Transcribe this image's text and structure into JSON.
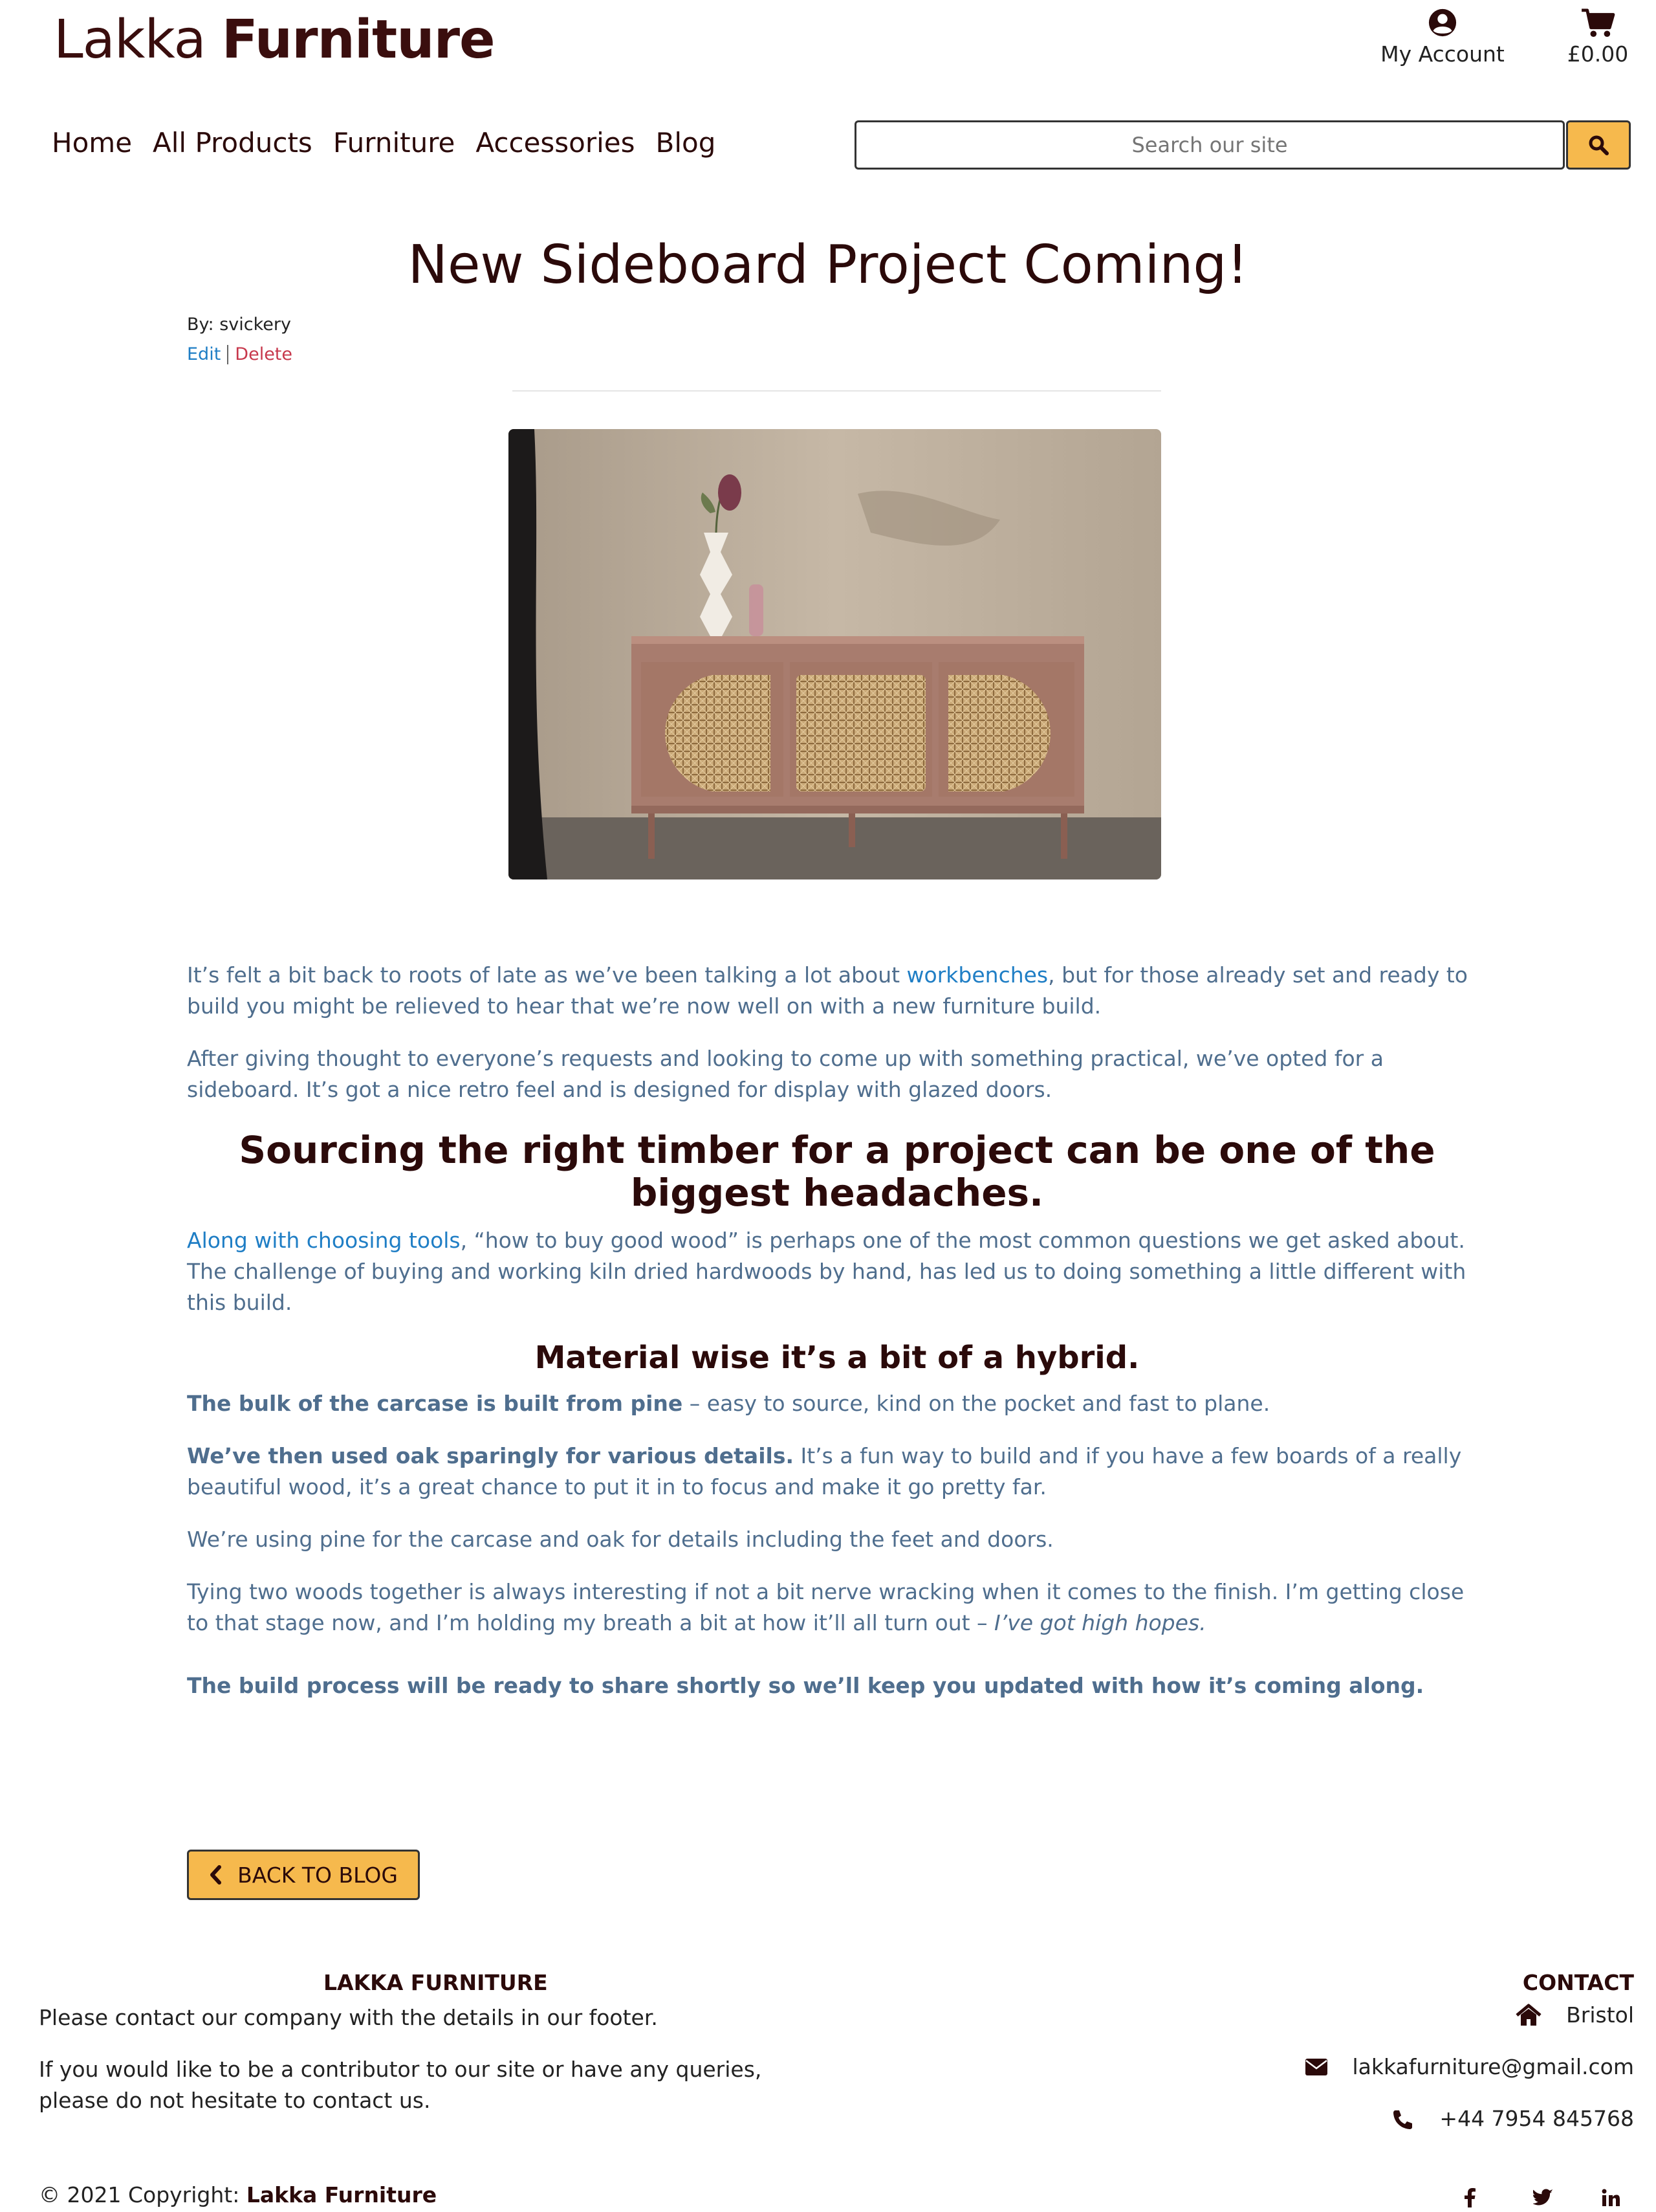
{
  "header": {
    "brand_light": "Lakka",
    "brand_bold": "Furniture",
    "account_label": "My Account",
    "cart_total": "£0.00"
  },
  "nav": {
    "items": [
      {
        "label": "Home"
      },
      {
        "label": "All Products"
      },
      {
        "label": "Furniture"
      },
      {
        "label": "Accessories"
      },
      {
        "label": "Blog"
      }
    ]
  },
  "search": {
    "placeholder": "Search our site"
  },
  "post": {
    "title": "New Sideboard Project Coming!",
    "byline": "By: svickery",
    "edit_label": "Edit",
    "delete_label": "Delete",
    "p1_a": "It’s felt a bit back to roots of late as we’ve been talking a lot about ",
    "p1_link": "workbenches",
    "p1_b": ", but for those already set and ready to build you might be relieved to hear that we’re now well on with a new furniture build.",
    "p2": "After giving thought to everyone’s requests and looking to come up with something practical, we’ve opted for a sideboard. It’s got a nice retro feel and is designed for display with glazed doors.",
    "h2": "Sourcing the right timber for a project can be one of the biggest headaches.",
    "p3_link": "Along with choosing tools",
    "p3_b": ", “how to buy good wood” is perhaps one of the most common questions we get asked about. The challenge of buying and working kiln dried hardwoods by hand, has led us to doing something a little different with this build.",
    "h3": "Material wise it’s a bit of a hybrid.",
    "p4_bold": "The bulk of the carcase is built from pine",
    "p4_rest": " – easy to source, kind on the pocket and fast to plane.",
    "p5_bold": "We’ve then used oak sparingly for various details.",
    "p5_rest": " It’s a fun way to build and if you have a few boards of a really beautiful wood, it’s a great chance to put it in to focus and make it go pretty far.",
    "p6": "We’re using pine for the carcase and oak for details including the feet and doors.",
    "p7_a": "Tying two woods together is always interesting if not a bit nerve wracking when it comes to the finish. I’m getting close to that stage now, and I’m holding my breath a bit at how it’ll all turn out – ",
    "p7_i": "I’ve got high hopes.",
    "p8_bold": "The build process will be ready to share shortly so we’ll keep you updated with how it’s coming along."
  },
  "back_button": {
    "label": "BACK TO BLOG"
  },
  "footer": {
    "about_heading": "LAKKA FURNITURE",
    "about_p1": "Please contact our company with the details in our footer.",
    "about_p2": "If you would like to be a contributor to our site or have any queries, please do not hesitate to contact us.",
    "contact_heading": "CONTACT",
    "location": "Bristol",
    "email": "lakkafurniture@gmail.com",
    "phone": "+44 7954 845768",
    "copyright_prefix": "© 2021 Copyright: ",
    "copyright_name": "Lakka Furniture"
  },
  "colors": {
    "accent": "#f6b94d",
    "heading": "#2b0a0a",
    "body_text": "#4f6e8e",
    "link": "#1f7ec5",
    "delete": "#c7384c"
  },
  "icons": [
    "user-circle-icon",
    "cart-icon",
    "search-icon",
    "chevron-left-icon",
    "home-icon",
    "envelope-icon",
    "phone-icon",
    "facebook-icon",
    "twitter-icon",
    "linkedin-icon"
  ]
}
